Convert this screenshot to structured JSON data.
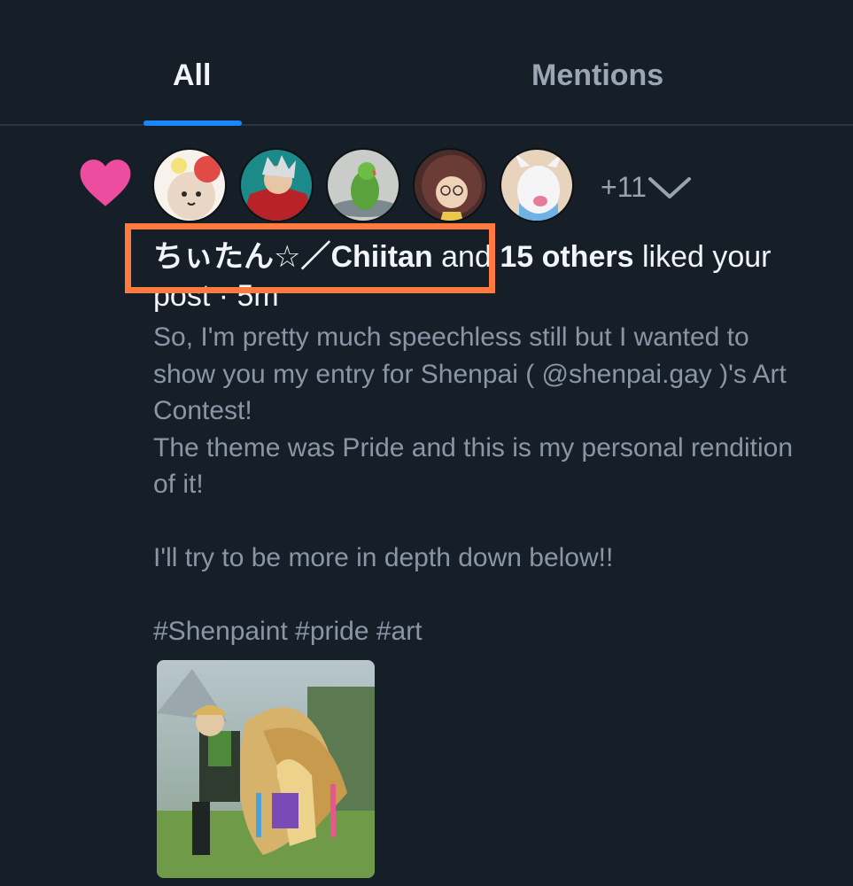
{
  "tabs": [
    {
      "label": "All",
      "active": true
    },
    {
      "label": "Mentions",
      "active": false
    }
  ],
  "notification": {
    "type_icon": "heart-icon",
    "accent_color": "#ec4d9f",
    "avatars": [
      "avatar-1",
      "avatar-2",
      "avatar-3",
      "avatar-4",
      "avatar-5"
    ],
    "more_count": "+11",
    "actor": "ちぃたん☆／Chiitan",
    "and_text": " and ",
    "others": "15 others",
    "action": " liked your post · 5m",
    "post_text": "So, I'm pretty much speechless still but I wanted to show you my entry for Shenpai ( @shenpai.gay )'s Art Contest!\nThe theme was Pride and this is my personal rendition of it!\n\nI'll try to be more in depth down below!!\n\n#Shenpaint #pride #art"
  }
}
